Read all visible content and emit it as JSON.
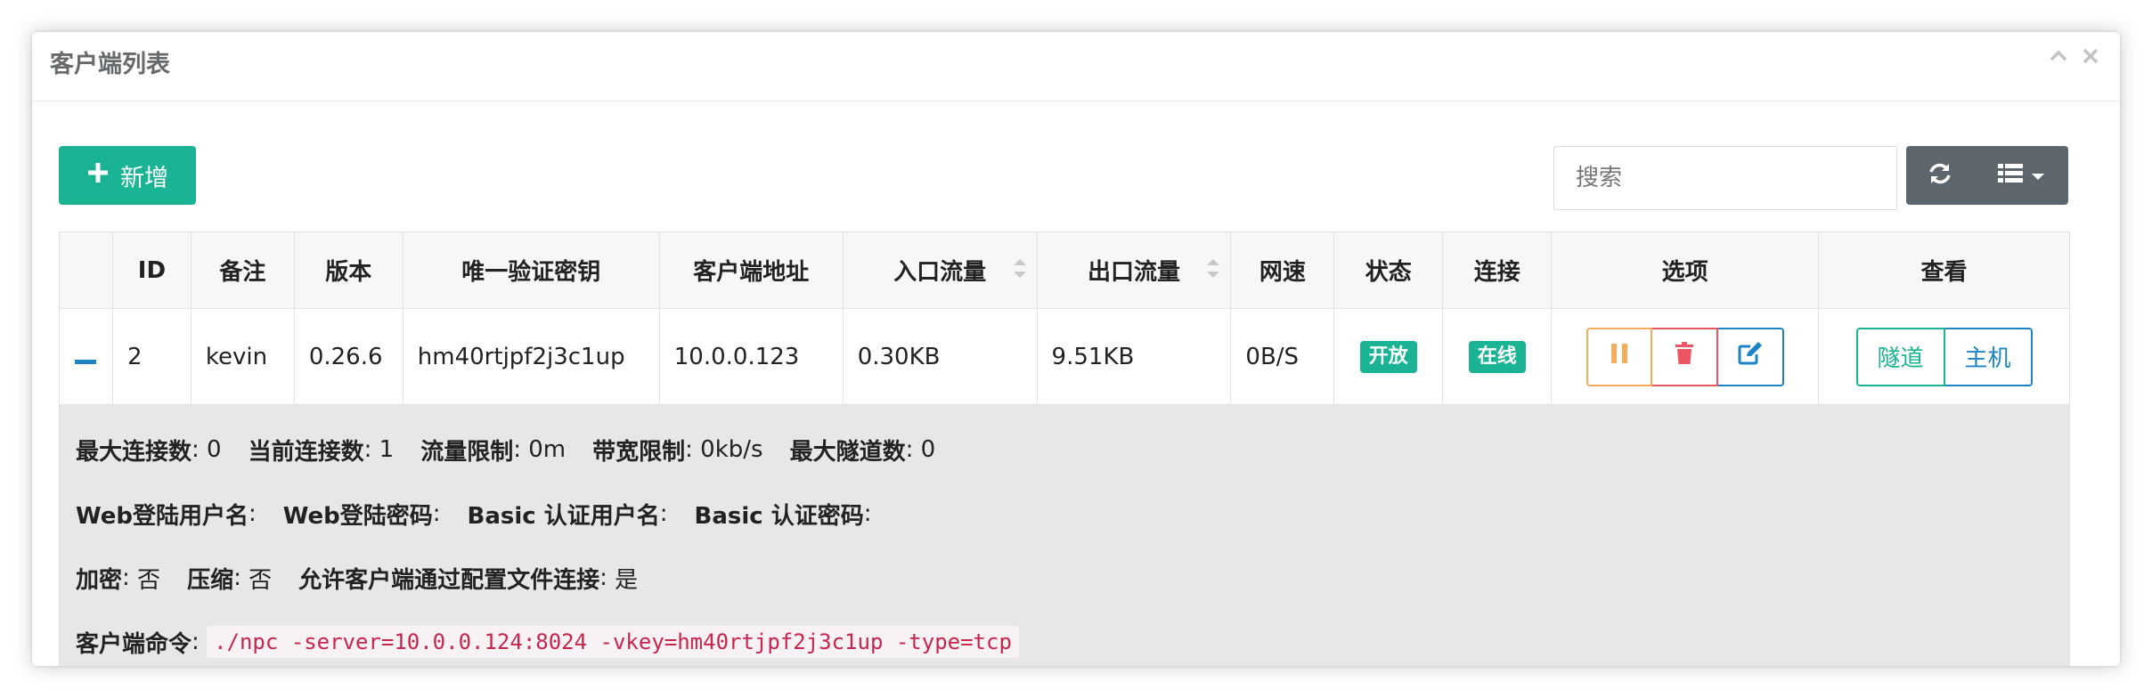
{
  "panel": {
    "title": "客户端列表"
  },
  "toolbar": {
    "add_label": "新增",
    "search_placeholder": "搜索"
  },
  "table": {
    "headers": [
      "ID",
      "备注",
      "版本",
      "唯一验证密钥",
      "客户端地址",
      "入口流量",
      "出口流量",
      "网速",
      "状态",
      "连接",
      "选项",
      "查看"
    ],
    "row": {
      "id": "2",
      "remark": "kevin",
      "version": "0.26.6",
      "vkey": "hm40rtjpf2j3c1up",
      "address": "10.0.0.123",
      "in_flow": "0.30KB",
      "out_flow": "9.51KB",
      "speed": "0B/S",
      "status": "开放",
      "connection": "在线",
      "view_tunnel": "隧道",
      "view_host": "主机"
    }
  },
  "detail": {
    "max_conn_label": "最大连接数",
    "max_conn": "0",
    "cur_conn_label": "当前连接数",
    "cur_conn": "1",
    "flow_limit_label": "流量限制",
    "flow_limit": "0m",
    "rate_limit_label": "带宽限制",
    "rate_limit": "0kb/s",
    "max_tunnel_label": "最大隧道数",
    "max_tunnel": "0",
    "web_user_label": "Web登陆用户名",
    "web_pass_label": "Web登陆密码",
    "basic_user_label": "Basic 认证用户名",
    "basic_pass_label": "Basic 认证密码",
    "encrypt_label": "加密",
    "encrypt": "否",
    "compress_label": "压缩",
    "compress": "否",
    "config_conn_label": "允许客户端通过配置文件连接",
    "config_conn": "是",
    "cmd_label": "客户端命令",
    "cmd": "./npc -server=10.0.0.124:8024 -vkey=hm40rtjpf2j3c1up -type=tcp"
  },
  "colors": {
    "primary": "#1ab394",
    "blue": "#1c84c6",
    "warning": "#f8ac59",
    "danger": "#ed5565",
    "dark": "#5d656d"
  }
}
